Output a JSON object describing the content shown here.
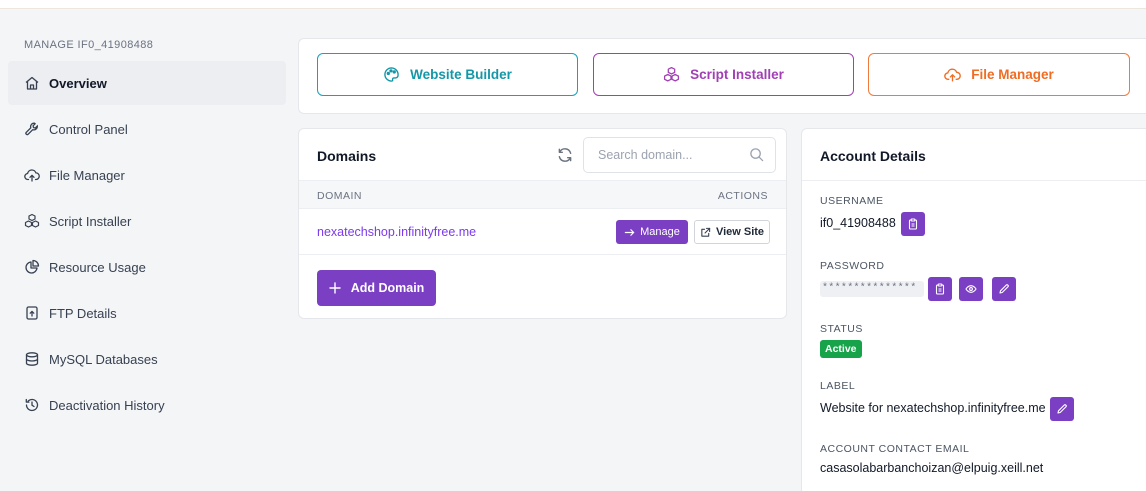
{
  "sidebar": {
    "heading": "MANAGE IF0_41908488",
    "items": [
      {
        "label": "Overview",
        "icon": "home-icon",
        "active": true
      },
      {
        "label": "Control Panel",
        "icon": "wrench-icon"
      },
      {
        "label": "File Manager",
        "icon": "cloud-upload-icon"
      },
      {
        "label": "Script Installer",
        "icon": "cubes-icon"
      },
      {
        "label": "Resource Usage",
        "icon": "pie-chart-icon"
      },
      {
        "label": "FTP Details",
        "icon": "file-upload-icon"
      },
      {
        "label": "MySQL Databases",
        "icon": "database-icon"
      },
      {
        "label": "Deactivation History",
        "icon": "history-icon"
      }
    ]
  },
  "quick_actions": [
    {
      "label": "Website Builder",
      "icon": "palette-icon",
      "color": "#17a2b8"
    },
    {
      "label": "Script Installer",
      "icon": "cubes-icon",
      "color": "#a23fb5"
    },
    {
      "label": "File Manager",
      "icon": "cloud-upload-icon",
      "color": "#f07a3b"
    }
  ],
  "domains": {
    "title": "Domains",
    "search_placeholder": "Search domain...",
    "columns": {
      "domain": "DOMAIN",
      "actions": "ACTIONS"
    },
    "rows": [
      {
        "domain": "nexatechshop.infinityfree.me",
        "manage_label": "Manage",
        "view_label": "View Site"
      }
    ],
    "add_label": "Add Domain"
  },
  "account": {
    "title": "Account Details",
    "username_label": "USERNAME",
    "username": "if0_41908488",
    "password_label": "PASSWORD",
    "password_mask": "***************",
    "status_label": "STATUS",
    "status": "Active",
    "label_label": "LABEL",
    "label_value": "Website for nexatechshop.infinityfree.me",
    "email_label": "ACCOUNT CONTACT EMAIL",
    "email": "casasolabarbanchoizan@elpuig.xeill.net"
  },
  "colors": {
    "primary": "#7b3fc4",
    "link": "#7c3aed",
    "success": "#16a34a"
  }
}
